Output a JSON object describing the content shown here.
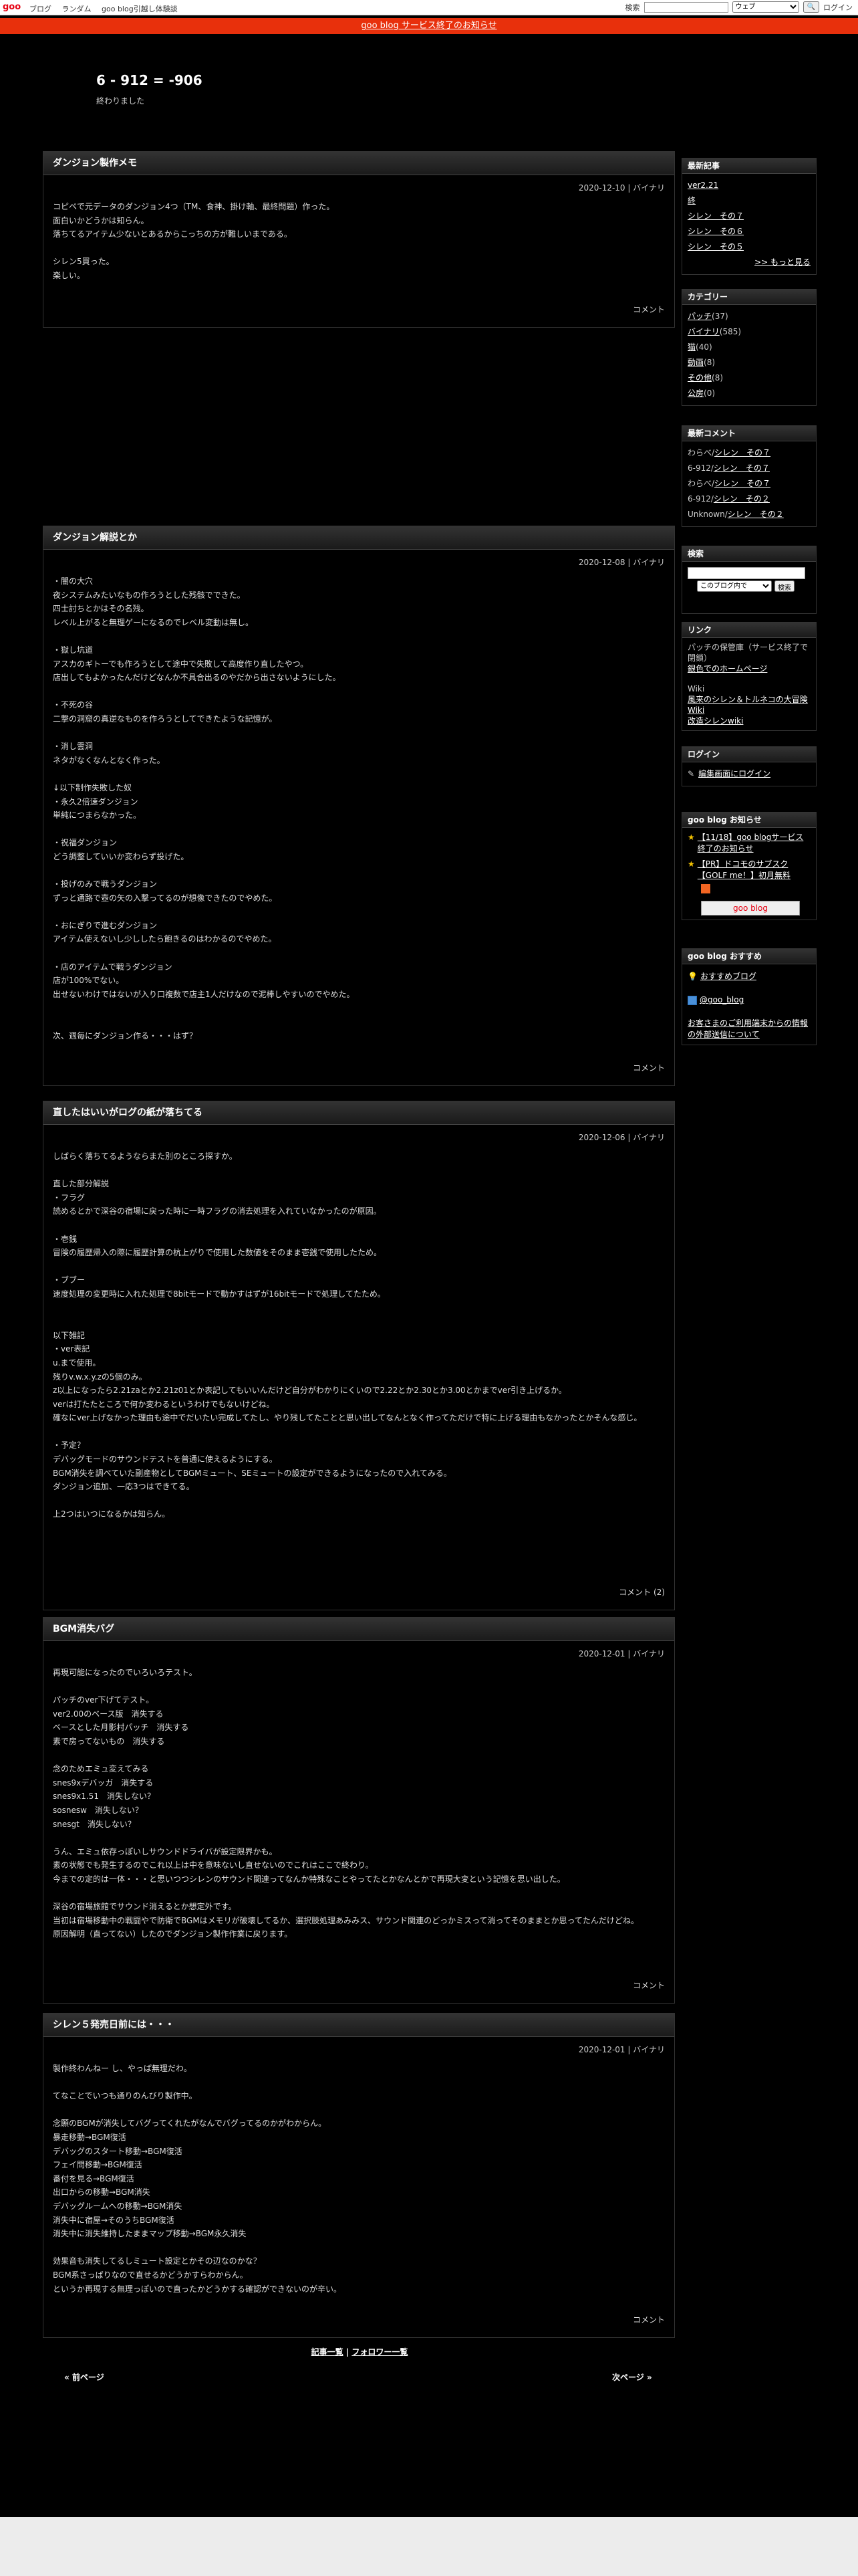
{
  "topbar": {
    "logo": "goo",
    "nav": [
      "ブログ",
      "ランダム",
      "goo blog引越し体験談"
    ],
    "search_label": "検索",
    "search_option": "ウェブ",
    "login": "ログイン"
  },
  "notice": "goo blog サービス終了のお知らせ",
  "blog": {
    "title": "6 - 912 = -906",
    "description": "終わりました"
  },
  "articles": [
    {
      "title": "ダンジョン製作メモ",
      "meta": "2020-12-10 | バイナリ",
      "body": "コピペで元データのダンジョン4つ（TM、食神、掛け軸、最終問題）作った。\n面白いかどうかは知らん。\n落ちてるアイテム少ないとあるからこっちの方が難しいまである。\n\nシレン5買った。\n楽しい。",
      "footer": "コメント"
    },
    {
      "title": "ダンジョン解説とか",
      "meta": "2020-12-08 | バイナリ",
      "body": "・闇の大穴\n夜システムみたいなもの作ろうとした残骸でできた。\n四士討ちとかはその名残。\nレベル上がると無理ゲーになるのでレベル変動は無し。\n\n・獄し坑道\nアスカのギトーでも作ろうとして途中で失敗して高度作り直したやつ。\n店出してもよかったんだけどなんか不具合出るのやだから出さないようにした。\n\n・不死の谷\n二撃の洞窟の真逆なものを作ろうとしてできたような記憶が。\n\n・消し雲洞\nネタがなくなんとなく作った。\n\n↓以下制作失敗した奴\n・永久2倍速ダンジョン\n単純につまらなかった。\n\n・祝福ダンジョン\nどう調整していいか変わらず投げた。\n\n・投げのみで戦うダンジョン\nずっと通路で壺の矢の入撃ってるのが想像できたのでやめた。\n\n・おにぎりで進むダンジョン\nアイテム使えないし少ししたら飽きるのはわかるのでやめた。\n\n・店のアイテムで戦うダンジョン\n店が100%でない。\n出せないわけではないが入り口複数で店主1人だけなので泥棒しやすいのでやめた。\n\n\n次、週毎にダンジョン作る・・・はず？",
      "footer": "コメント"
    },
    {
      "title": "直したはいいがログの紙が落ちてる",
      "meta": "2020-12-06 | バイナリ",
      "body": "しばらく落ちてるようならまた別のところ探すか。\n\n直した部分解説\n・フラグ\n読めるとかで深谷の宿場に戻った時に一時フラグの消去処理を入れていなかったのが原因。\n\n・壱銭\n冒険の履歴帰入の際に履歴計算の杭上がりで使用した数値をそのまま壱銭で使用したため。\n\n・ブブー\n速度処理の変更時に入れた処理で8bitモードで動かすはずが16bitモードで処理してたため。\n\n\n以下雑記\n・ver表記\nu.まで使用。\n残りv.w.x.y.zの5個のみ。\nz以上になったら2.21zaとか2.21z01とか表記してもいいんだけど自分がわかりにくいので2.22とか2.30とか3.00とかまでver引き上げるか。\nverは打たたところで何か変わるというわけでもないけどね。\n確なにver上げなかった理由も途中でだいたい完成してたし、やり残してたことと思い出してなんとなく作ってただけで特に上げる理由もなかったとかそんな感じ。\n\n・予定？\nデバッグモードのサウンドテストを普通に使えるようにする。\nBGM消失を調べていた副産物としてBGMミュート、SEミュートの設定ができるようになったので入れてみる。\nダンジョン追加、一応3つはできてる。\n\n上2つはいつになるかは知らん。",
      "footer": "コメント (2)"
    },
    {
      "title": "BGM消失バグ",
      "meta": "2020-12-01 | バイナリ",
      "body": "再現可能になったのでいろいろテスト。\n\nパッチのver下げてテスト。\nver2.00のベース版　消失する\nベースとした月影村パッチ　消失する\n素で房ってないもの　消失する\n\n念のためエミュ変えてみる\nsnes9xデバッガ　消失する\nsnes9x1.51　消失しない？\nsosnesw　消失しない？\nsnesgt　消失しない？\n\nうん、エミュ依存っぽいしサウンドドライバが設定限界かも。\n素の状態でも発生するのでこれ以上は中を意味ないし直せないのでこれはここで終わり。\n今までの定的は一体・・・と思いつつシレンのサウンド関連ってなんか特殊なことやってたとかなんとかで再現大変という記憶を思い出した。\n\n深谷の宿場旅館でサウンド消えるとか想定外です。\n当初は宿場移動中の戦闘やで防衛でBGMはメモリが破壊してるか、選択肢処理あみみス、サウンド関連のどっかミスって消ってそのままとか思ってたんだけどね。\n原因解明（直ってない）したのでダンジョン製作作業に戻ります。",
      "footer": "コメント"
    },
    {
      "title": "シレン５発売日前には・・・",
      "meta": "2020-12-01 | バイナリ",
      "body": "製作終わんねー し、やっぱ無理だわ。\n\nてなことでいつも通りのんびり製作中。\n\n念願のBGMが消失してバグってくれたがなんでバグってるのかがわからん。\n暴走移動→BGM復活\nデバッグのスタート移動→BGM復活\nフェイ問移動→BGM復活\n番付を見る→BGM復活\n出口からの移動→BGM消失\nデバッグルームへの移動→BGM消失\n消失中に宿屋→そのうちBGM復活\n消失中に消失維持したままマップ移動→BGM永久消失\n\n効果音も消失してるしミュート設定とかその辺なのかな？\nBGM系さっぱりなので直せるかどうかすらわからん。\nというか再現する無理っぽいので直ったかどうかする確認ができないのが辛い。",
      "footer": "コメント"
    }
  ],
  "sidebar": {
    "recent": {
      "title": "最新記事",
      "items": [
        "ver2.21",
        "終",
        "シレン　その７",
        "シレン　その６",
        "シレン　その５"
      ],
      "more": ">> もっと見る"
    },
    "categories": {
      "title": "カテゴリー",
      "items": [
        {
          "name": "パッチ",
          "count": "(37)"
        },
        {
          "name": "バイナリ",
          "count": "(585)"
        },
        {
          "name": "猫",
          "count": "(40)"
        },
        {
          "name": "動画",
          "count": "(8)"
        },
        {
          "name": "その他",
          "count": "(8)"
        },
        {
          "name": "公房",
          "count": "(0)"
        }
      ]
    },
    "comments": {
      "title": "最新コメント",
      "items": [
        {
          "author": "わらべ/",
          "link": "シレン　その７"
        },
        {
          "author": "6-912/",
          "link": "シレン　その７"
        },
        {
          "author": "わらべ/",
          "link": "シレン　その７"
        },
        {
          "author": "6-912/",
          "link": "シレン　その２"
        },
        {
          "author": "Unknown/",
          "link": "シレン　その２"
        }
      ]
    },
    "search": {
      "title": "検索",
      "scope": "このブログ内で",
      "button": "検索"
    },
    "links": {
      "title": "リンク",
      "line1": "パッチの保管庫（サービス終了で閉鎖）",
      "link1": "銀色でのホームページ",
      "wiki_label": "Wiki",
      "link2": "風来のシレン＆トルネコの大冒険 Wiki",
      "link3": "改造シレンwiki"
    },
    "login": {
      "title": "ログイン",
      "link": "編集画面にログイン"
    },
    "goo_notice": {
      "title": "goo blog お知らせ",
      "item1": "【11/18】goo blogサービス終了のお知らせ",
      "item2": "【PR】ドコモのサブスク【GOLF me！】初月無料",
      "goo_button": "goo blog"
    },
    "recommend": {
      "title": "goo blog おすすめ",
      "item1": "おすすめブログ",
      "item2": "@goo_blog",
      "item3": "お客さまのご利用端末からの情報の外部送信について"
    }
  },
  "pager": {
    "center_a": "記事一覧",
    "separator": "|",
    "center_b": "フォロワー一覧",
    "prev": "« 前ページ",
    "next": "次ページ »"
  }
}
